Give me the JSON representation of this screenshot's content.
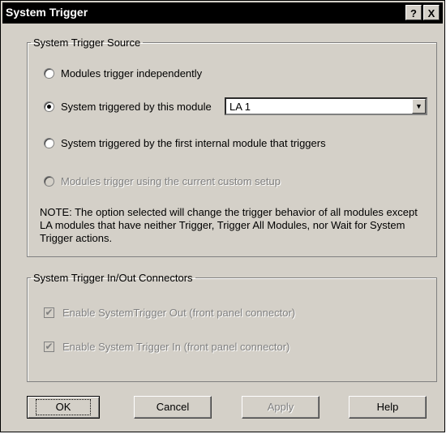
{
  "window": {
    "title": "System Trigger",
    "help_label": "?",
    "close_label": "X"
  },
  "source": {
    "legend": "System Trigger Source",
    "options": [
      {
        "label": "Modules trigger independently",
        "checked": false,
        "enabled": true
      },
      {
        "label": "System triggered by this module",
        "checked": true,
        "enabled": true
      },
      {
        "label": "System triggered by the first internal module that triggers",
        "checked": false,
        "enabled": true
      },
      {
        "label": "Modules trigger using the current custom setup",
        "checked": false,
        "enabled": false
      }
    ],
    "module_select": {
      "value": "LA 1"
    },
    "note": "NOTE: The option selected will change the trigger behavior of all modules except LA modules that have neither Trigger, Trigger All Modules, nor Wait for System Trigger actions."
  },
  "connectors": {
    "legend": "System Trigger In/Out Connectors",
    "options": [
      {
        "label": "Enable SystemTrigger Out (front panel connector)",
        "checked": true,
        "enabled": false
      },
      {
        "label": "Enable System Trigger In (front panel connector)",
        "checked": true,
        "enabled": false
      }
    ]
  },
  "buttons": {
    "ok": "OK",
    "cancel": "Cancel",
    "apply": "Apply",
    "help": "Help"
  }
}
